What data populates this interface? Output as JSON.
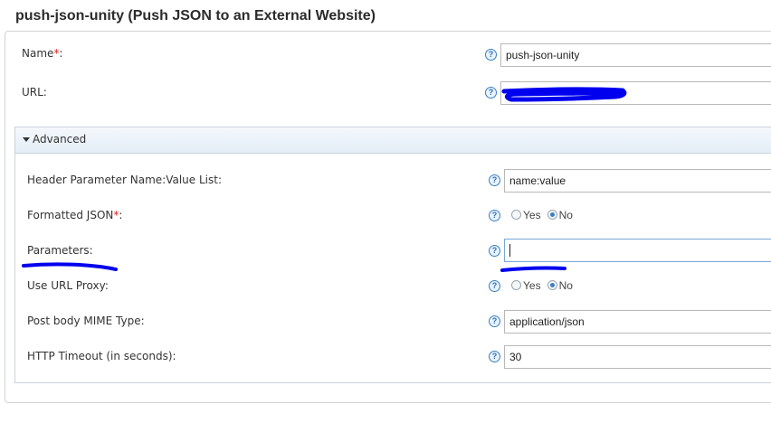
{
  "page": {
    "title": "push-json-unity (Push JSON to an External Website)"
  },
  "help_glyph": "?",
  "fields": {
    "name": {
      "label": "Name",
      "required_mark": "*",
      "suffix": ":",
      "value": "push-json-unity"
    },
    "url": {
      "label": "URL:",
      "value": ""
    }
  },
  "advanced": {
    "label": "Advanced",
    "header_params": {
      "label": "Header Parameter Name:Value List:",
      "value": "name:value"
    },
    "formatted_json": {
      "label": "Formatted JSON",
      "required_mark": "*",
      "suffix": ":",
      "options": [
        "Yes",
        "No"
      ],
      "selected": "No"
    },
    "parameters": {
      "label": "Parameters:",
      "value": ""
    },
    "use_url_proxy": {
      "label": "Use URL Proxy:",
      "options": [
        "Yes",
        "No"
      ],
      "selected": "No"
    },
    "post_body_mime": {
      "label": "Post body MIME Type:",
      "value": "application/json"
    },
    "http_timeout": {
      "label": "HTTP Timeout (in seconds):",
      "value": "30"
    }
  },
  "colors": {
    "redaction": "#0000ee",
    "help_border": "#3a7fc2",
    "required": "#e02020"
  }
}
